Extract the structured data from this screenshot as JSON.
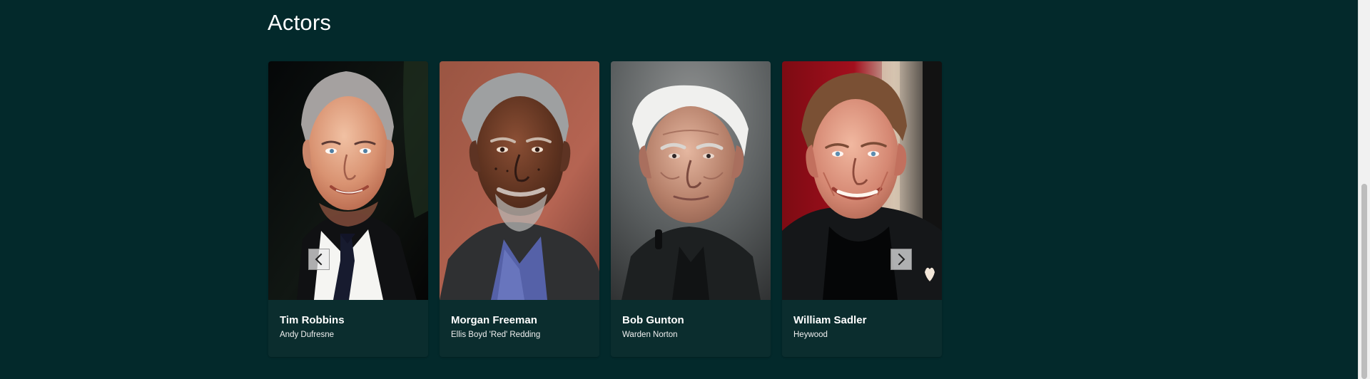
{
  "section": {
    "title": "Actors"
  },
  "cards": [
    {
      "name": "Tim Robbins",
      "character": "Andy Dufresne",
      "photo_icon": "actor-portrait-icon"
    },
    {
      "name": "Morgan Freeman",
      "character": "Ellis Boyd 'Red' Redding",
      "photo_icon": "actor-portrait-icon"
    },
    {
      "name": "Bob Gunton",
      "character": "Warden Norton",
      "photo_icon": "actor-portrait-icon"
    },
    {
      "name": "William Sadler",
      "character": "Heywood",
      "photo_icon": "actor-portrait-icon"
    }
  ],
  "controls": {
    "prev_icon": "chevron-left-icon",
    "next_icon": "chevron-right-icon"
  },
  "colors": {
    "background": "#03292b",
    "card_background": "#0c2f30",
    "text": "#ffffff"
  }
}
